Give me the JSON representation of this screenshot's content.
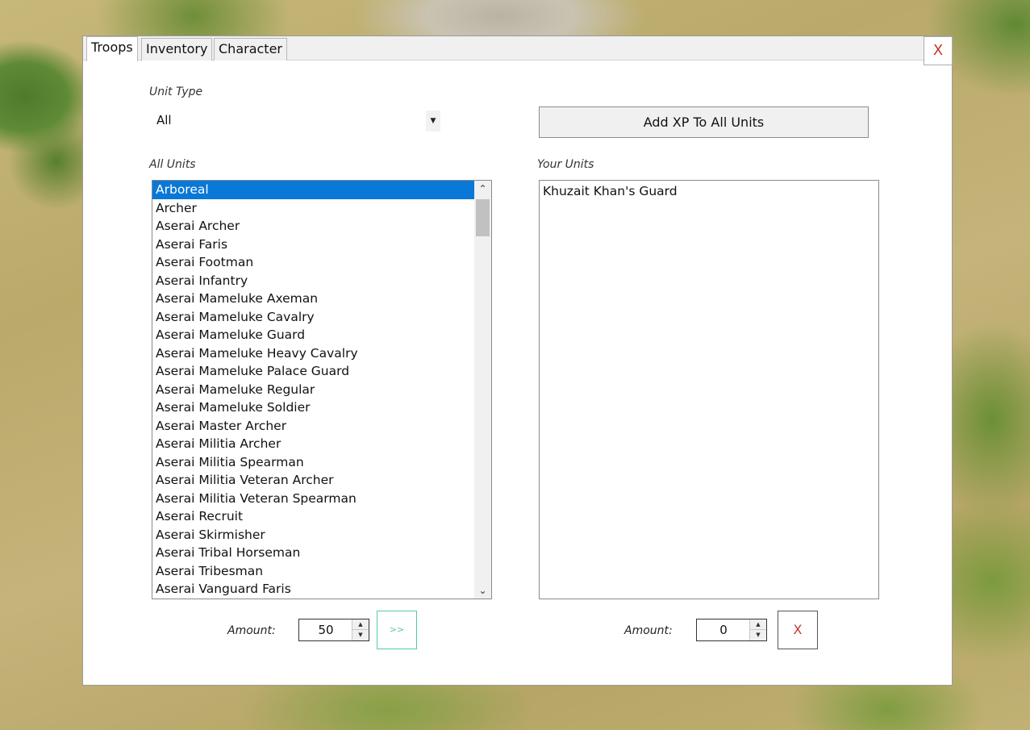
{
  "tabs": [
    {
      "label": "Troops",
      "active": true
    },
    {
      "label": "Inventory",
      "active": false
    },
    {
      "label": "Character",
      "active": false
    }
  ],
  "close_label": "X",
  "unit_type": {
    "label": "Unit Type",
    "selected": "All"
  },
  "add_xp_label": "Add XP To All Units",
  "all_units": {
    "label": "All Units",
    "selected": "Arboreal",
    "items": [
      "Arboreal",
      "Archer",
      "Aserai Archer",
      "Aserai Faris",
      "Aserai Footman",
      "Aserai Infantry",
      "Aserai Mameluke Axeman",
      "Aserai Mameluke Cavalry",
      "Aserai Mameluke Guard",
      "Aserai Mameluke Heavy Cavalry",
      "Aserai Mameluke Palace Guard",
      "Aserai Mameluke Regular",
      "Aserai Mameluke Soldier",
      "Aserai Master Archer",
      "Aserai Militia Archer",
      "Aserai Militia Spearman",
      "Aserai Militia Veteran Archer",
      "Aserai Militia Veteran Spearman",
      "Aserai Recruit",
      "Aserai Skirmisher",
      "Aserai Tribal Horseman",
      "Aserai Tribesman",
      "Aserai Vanguard Faris"
    ]
  },
  "your_units": {
    "label": "Your Units",
    "items": [
      "Khuzait Khan's Guard"
    ]
  },
  "left_amount": {
    "label": "Amount:",
    "value": "50"
  },
  "transfer_label": ">>",
  "right_amount": {
    "label": "Amount:",
    "value": "0"
  },
  "remove_label": "X",
  "icons": {
    "dropdown": "chevron-down-icon",
    "scroll_up": "chevron-up-icon",
    "scroll_down": "chevron-down-icon"
  },
  "colors": {
    "selection": "#0a78d7",
    "transfer_accent": "#55c8a8",
    "close_red": "#c0392b"
  }
}
